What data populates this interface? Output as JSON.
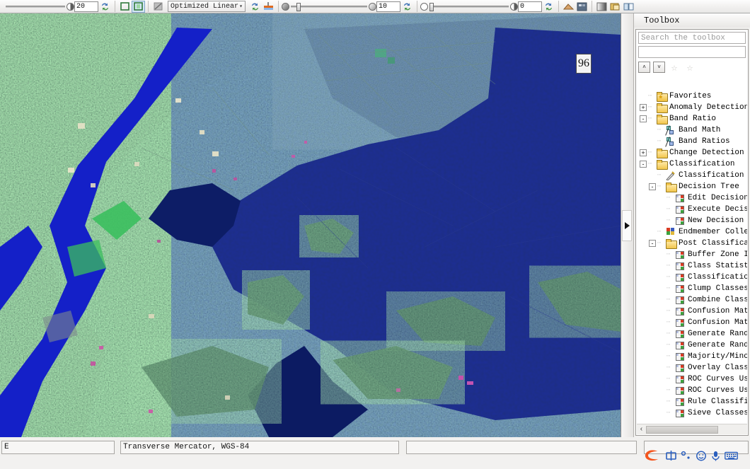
{
  "toolbar": {
    "brightness_value": "20",
    "contrast_value": "10",
    "sharpen_value": "0",
    "stretch_label": "Optimized Linear",
    "icons": [
      {
        "name": "contrast-icon"
      },
      {
        "name": "refresh-stretch-icon"
      },
      {
        "name": "fit-to-window-icon"
      },
      {
        "name": "zoom-to-extent-icon"
      },
      {
        "name": "no-stretch-icon"
      },
      {
        "name": "reset-stretch-icon"
      },
      {
        "name": "transparency-icon"
      },
      {
        "name": "blend-icon"
      },
      {
        "name": "flicker-icon"
      },
      {
        "name": "swipe-icon"
      },
      {
        "name": "portal-icon"
      }
    ]
  },
  "view": {
    "label_96": "96",
    "splitter_arrow": "▶"
  },
  "toolbox": {
    "title": "Toolbox",
    "search_placeholder": "Search the toolbox",
    "result_value": "",
    "buttons": {
      "collapse_label": "˄",
      "expand_label": "˅",
      "add_favorite": "☆",
      "remove_favorite": "☆"
    },
    "scroll_left": "‹",
    "tree": [
      {
        "label": "Favorites",
        "depth": 1,
        "icon": "favorites",
        "expander": ""
      },
      {
        "label": "Anomaly Detection",
        "depth": 1,
        "icon": "folder",
        "expander": "+"
      },
      {
        "label": "Band Ratio",
        "depth": 1,
        "icon": "folder",
        "expander": "-"
      },
      {
        "label": "Band Math",
        "depth": 2,
        "icon": "bm",
        "expander": ""
      },
      {
        "label": "Band Ratios",
        "depth": 2,
        "icon": "bm",
        "expander": ""
      },
      {
        "label": "Change Detection",
        "depth": 1,
        "icon": "folder",
        "expander": "+"
      },
      {
        "label": "Classification",
        "depth": 1,
        "icon": "folder",
        "expander": "-"
      },
      {
        "label": "Classification Wo",
        "depth": 2,
        "icon": "wand",
        "expander": ""
      },
      {
        "label": "Decision Tree",
        "depth": 2,
        "icon": "folder",
        "expander": "-"
      },
      {
        "label": "Edit Decision",
        "depth": 3,
        "icon": "tool",
        "expander": ""
      },
      {
        "label": "Execute Decisi",
        "depth": 3,
        "icon": "tool",
        "expander": ""
      },
      {
        "label": "New Decision T",
        "depth": 3,
        "icon": "tool",
        "expander": ""
      },
      {
        "label": "Endmember Collect",
        "depth": 2,
        "icon": "em",
        "expander": ""
      },
      {
        "label": "Post Classificati",
        "depth": 2,
        "icon": "folder",
        "expander": "-"
      },
      {
        "label": "Buffer Zone Im",
        "depth": 3,
        "icon": "tool",
        "expander": ""
      },
      {
        "label": "Class Statisti",
        "depth": 3,
        "icon": "tool",
        "expander": ""
      },
      {
        "label": "Classification",
        "depth": 3,
        "icon": "tool",
        "expander": ""
      },
      {
        "label": "Clump Classes",
        "depth": 3,
        "icon": "tool",
        "expander": ""
      },
      {
        "label": "Combine Classe",
        "depth": 3,
        "icon": "tool",
        "expander": ""
      },
      {
        "label": "Confusion Matr",
        "depth": 3,
        "icon": "tool",
        "expander": ""
      },
      {
        "label": "Confusion Matr",
        "depth": 3,
        "icon": "tool",
        "expander": ""
      },
      {
        "label": "Generate Rando",
        "depth": 3,
        "icon": "tool",
        "expander": ""
      },
      {
        "label": "Generate Rando",
        "depth": 3,
        "icon": "tool",
        "expander": ""
      },
      {
        "label": "Majority/Minor",
        "depth": 3,
        "icon": "tool",
        "expander": ""
      },
      {
        "label": "Overlay Classe",
        "depth": 3,
        "icon": "tool",
        "expander": ""
      },
      {
        "label": "ROC Curves Usi",
        "depth": 3,
        "icon": "tool",
        "expander": ""
      },
      {
        "label": "ROC Curves Usi",
        "depth": 3,
        "icon": "tool",
        "expander": ""
      },
      {
        "label": "Rule Classifie",
        "depth": 3,
        "icon": "tool",
        "expander": ""
      },
      {
        "label": "Sieve Classes",
        "depth": 3,
        "icon": "tool",
        "expander": ""
      }
    ]
  },
  "statusbar": {
    "left_value": "E",
    "projection": "Transverse Mercator, WGS-84",
    "right_value": "",
    "end_value": ""
  },
  "tray": {
    "items": [
      {
        "name": "sogou-logo-icon",
        "glyph": "S"
      },
      {
        "name": "ime-mode-icon",
        "glyph": "中"
      },
      {
        "name": "punctuation-icon",
        "glyph": "°,"
      },
      {
        "name": "emoji-icon",
        "glyph": "☺"
      },
      {
        "name": "voice-input-icon",
        "glyph": "●"
      },
      {
        "name": "keyboard-icon",
        "glyph": "⌨"
      }
    ]
  },
  "colors": {
    "water": "#101f6e",
    "land": "#2e5840",
    "nodata": "#000000",
    "accent": "#f2c64d"
  }
}
